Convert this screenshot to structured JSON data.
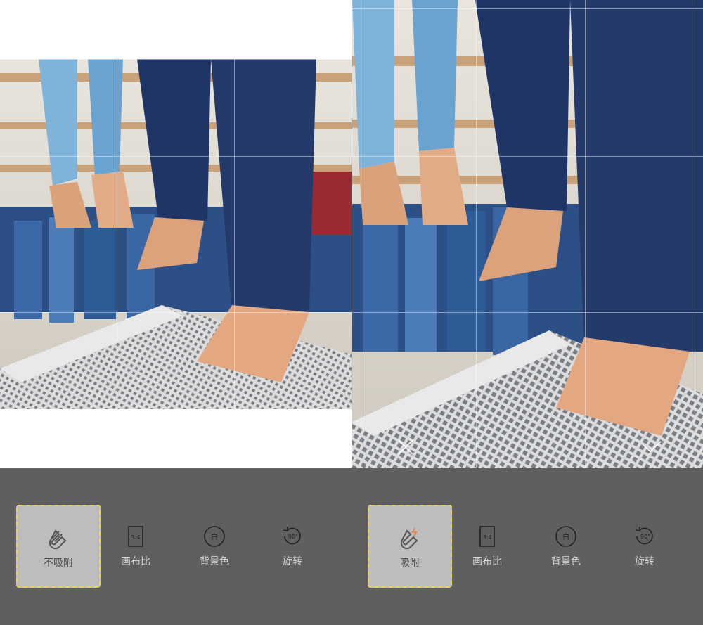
{
  "panels": [
    {
      "id": "left",
      "tools": [
        {
          "id": "magnet",
          "label": "不吸附",
          "icon": "magnet-off-icon",
          "selected": true
        },
        {
          "id": "ratio",
          "label": "画布比",
          "icon": "ratio-icon",
          "icon_text": "3:4",
          "selected": false
        },
        {
          "id": "bg",
          "label": "背景色",
          "icon": "background-color-icon",
          "icon_text": "白",
          "selected": false
        },
        {
          "id": "rotate",
          "label": "旋转",
          "icon": "rotate-icon",
          "icon_text": "90°",
          "selected": false
        }
      ]
    },
    {
      "id": "right",
      "tools": [
        {
          "id": "magnet",
          "label": "吸附",
          "icon": "magnet-on-icon",
          "selected": true
        },
        {
          "id": "ratio",
          "label": "画布比",
          "icon": "ratio-icon",
          "icon_text": "3:4",
          "selected": false
        },
        {
          "id": "bg",
          "label": "背景色",
          "icon": "background-color-icon",
          "icon_text": "白",
          "selected": false
        },
        {
          "id": "rotate",
          "label": "旋转",
          "icon": "rotate-icon",
          "icon_text": "90°",
          "selected": false
        }
      ]
    }
  ],
  "colors": {
    "toolbar_bg": "#5f5f5f",
    "selected_bg": "#bdbdbd",
    "selected_border": "#e8d84a",
    "magnet_spark": "#e8833a"
  }
}
